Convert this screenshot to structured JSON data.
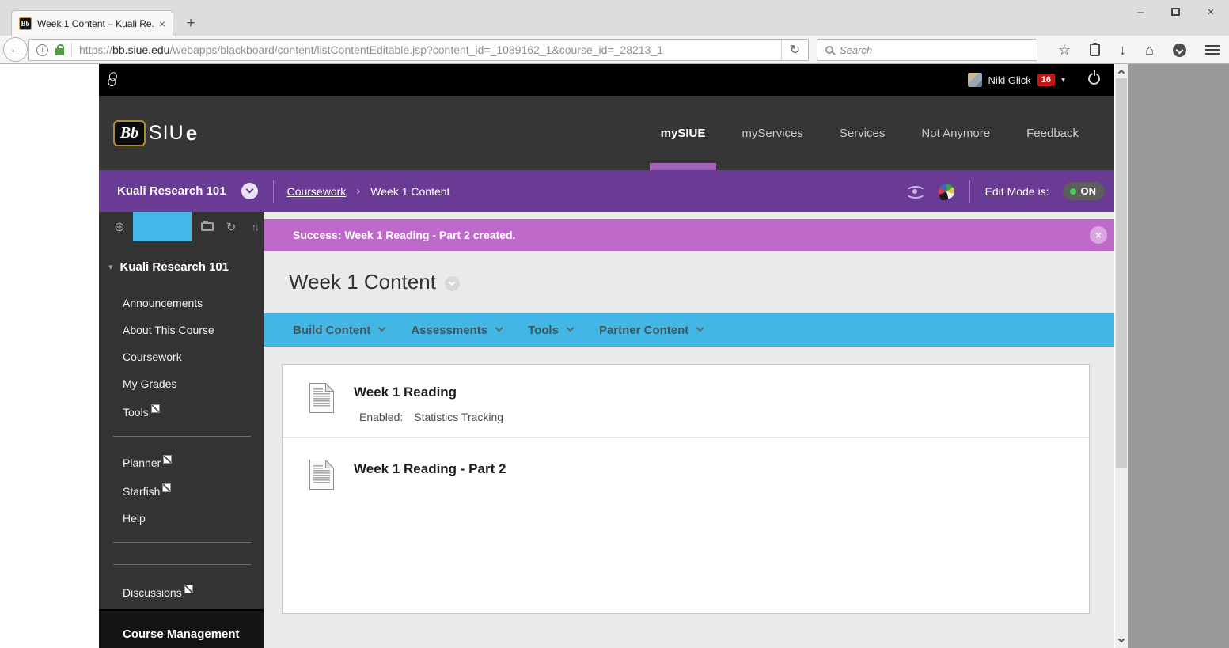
{
  "browser": {
    "tab_title": "Week 1 Content – Kuali Re...",
    "favicon_text": "Bb",
    "url_scheme": "https://",
    "url_domain": "bb.siue.edu",
    "url_path": "/webapps/blackboard/content/listContentEditable.jsp?content_id=_1089162_1&course_id=_28213_1",
    "search_placeholder": "Search"
  },
  "utility_bar": {
    "user_name": "Niki Glick",
    "notification_count": "16"
  },
  "brand": {
    "logo_bb": "Bb",
    "logo_text": "SIU",
    "logo_suffix": "e",
    "nav": [
      {
        "label": "mySIUE",
        "active": true
      },
      {
        "label": "myServices",
        "active": false
      },
      {
        "label": "Services",
        "active": false
      },
      {
        "label": "Not Anymore",
        "active": false
      },
      {
        "label": "Feedback",
        "active": false
      }
    ]
  },
  "course_bar": {
    "course_name": "Kuali Research 101",
    "breadcrumb_link": "Coursework",
    "breadcrumb_separator": "›",
    "breadcrumb_current": "Week 1 Content",
    "edit_mode_label": "Edit Mode is:",
    "edit_mode_state": "ON"
  },
  "sidebar": {
    "course_title": "Kuali Research 101",
    "items": [
      {
        "label": "Announcements",
        "hidden": false
      },
      {
        "label": "About This Course",
        "hidden": false
      },
      {
        "label": "Coursework",
        "hidden": false
      },
      {
        "label": "My Grades",
        "hidden": false
      },
      {
        "label": "Tools",
        "hidden": true
      },
      {
        "label": "Planner",
        "hidden": true
      },
      {
        "label": "Starfish",
        "hidden": true
      },
      {
        "label": "Help",
        "hidden": false
      },
      {
        "label": "Discussions",
        "hidden": true
      }
    ],
    "course_management_title": "Course Management"
  },
  "main": {
    "alert_message": "Success: Week 1 Reading - Part 2 created.",
    "page_title": "Week 1 Content",
    "action_buttons": [
      {
        "label": "Build Content"
      },
      {
        "label": "Assessments"
      },
      {
        "label": "Tools"
      },
      {
        "label": "Partner Content"
      }
    ],
    "content_items": [
      {
        "title": "Week 1 Reading",
        "meta_label": "Enabled:",
        "meta_value": "Statistics Tracking"
      },
      {
        "title": "Week 1 Reading - Part 2"
      }
    ]
  },
  "icons": {
    "back": "←",
    "reload": "↻",
    "close": "×",
    "minimize": "–",
    "new_tab": "+",
    "star": "☆",
    "download": "↓",
    "home": "⌂",
    "info": "i",
    "caret_down": "▾",
    "add": "⊕",
    "refresh": "↻",
    "reorder": "↑↓"
  },
  "colors": {
    "header_purple": "#6a3b94",
    "accent_purple": "#a263bd",
    "alert_purple": "#bf6acb",
    "action_blue": "#42b6e4",
    "badge_red": "#c11616",
    "edit_on_green": "#3fd34f"
  }
}
